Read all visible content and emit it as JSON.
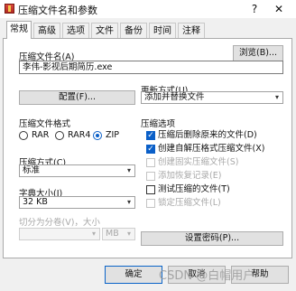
{
  "window": {
    "title": "压缩文件名和参数",
    "help": "?",
    "close": "✕"
  },
  "tabs": [
    "常规",
    "高级",
    "选项",
    "文件",
    "备份",
    "时间",
    "注释"
  ],
  "general": {
    "archive_name_label": "压缩文件名(A)",
    "archive_name_value": "李伟-影视后期简历.exe",
    "browse_button": "浏览(B)...",
    "profiles_button": "配置(F)...",
    "update_mode_label": "更新方式(U)",
    "update_mode_value": "添加并替换文件",
    "format_label": "压缩文件格式",
    "formats": [
      "RAR",
      "RAR4",
      "ZIP"
    ],
    "selected_format": "ZIP",
    "method_label": "压缩方式(C)",
    "method_value": "标准",
    "dict_label": "字典大小(I)",
    "dict_value": "32 KB",
    "split_label": "切分为分卷(V)，大小",
    "split_unit": "MB",
    "options_label": "压缩选项",
    "options": [
      {
        "label": "压缩后删除原来的文件(D)",
        "checked": true,
        "enabled": true
      },
      {
        "label": "创建自解压格式压缩文件(X)",
        "checked": true,
        "enabled": true
      },
      {
        "label": "创建固实压缩文件(S)",
        "checked": false,
        "enabled": false
      },
      {
        "label": "添加恢复记录(E)",
        "checked": false,
        "enabled": false
      },
      {
        "label": "测试压缩的文件(T)",
        "checked": false,
        "enabled": true
      },
      {
        "label": "锁定压缩文件(L)",
        "checked": false,
        "enabled": false
      }
    ],
    "password_button": "设置密码(P)..."
  },
  "footer": {
    "ok": "确定",
    "cancel": "取消",
    "help": "帮助"
  },
  "watermark": "CSDN @白帽用户"
}
